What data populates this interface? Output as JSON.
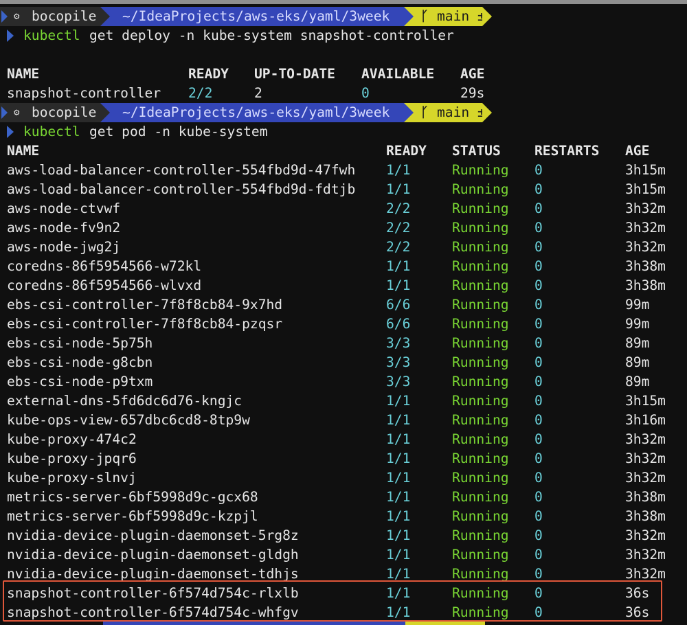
{
  "prompts": [
    {
      "user": "bocopile",
      "path": "~/IdeaProjects/aws-eks/yaml/3week",
      "branch_icon": "branch-icon",
      "branch": "main ±",
      "command": "kubectl",
      "args": "get deploy -n kube-system snapshot-controller"
    },
    {
      "user": "bocopile",
      "path": "~/IdeaProjects/aws-eks/yaml/3week",
      "branch_icon": "branch-icon",
      "branch": "main ±",
      "command": "kubectl",
      "args": "get pod -n kube-system"
    }
  ],
  "deploy_table": {
    "headers": [
      "NAME",
      "READY",
      "UP-TO-DATE",
      "AVAILABLE",
      "AGE"
    ],
    "rows": [
      [
        "snapshot-controller",
        "2/2",
        "2",
        "0",
        "29s"
      ]
    ]
  },
  "pod_table": {
    "headers": [
      "NAME",
      "READY",
      "STATUS",
      "RESTARTS",
      "AGE"
    ],
    "rows": [
      [
        "aws-load-balancer-controller-554fbd9d-47fwh",
        "1/1",
        "Running",
        "0",
        "3h15m"
      ],
      [
        "aws-load-balancer-controller-554fbd9d-fdtjb",
        "1/1",
        "Running",
        "0",
        "3h15m"
      ],
      [
        "aws-node-ctvwf",
        "2/2",
        "Running",
        "0",
        "3h32m"
      ],
      [
        "aws-node-fv9n2",
        "2/2",
        "Running",
        "0",
        "3h32m"
      ],
      [
        "aws-node-jwg2j",
        "2/2",
        "Running",
        "0",
        "3h32m"
      ],
      [
        "coredns-86f5954566-w72kl",
        "1/1",
        "Running",
        "0",
        "3h38m"
      ],
      [
        "coredns-86f5954566-wlvxd",
        "1/1",
        "Running",
        "0",
        "3h38m"
      ],
      [
        "ebs-csi-controller-7f8f8cb84-9x7hd",
        "6/6",
        "Running",
        "0",
        "99m"
      ],
      [
        "ebs-csi-controller-7f8f8cb84-pzqsr",
        "6/6",
        "Running",
        "0",
        "99m"
      ],
      [
        "ebs-csi-node-5p75h",
        "3/3",
        "Running",
        "0",
        "89m"
      ],
      [
        "ebs-csi-node-g8cbn",
        "3/3",
        "Running",
        "0",
        "89m"
      ],
      [
        "ebs-csi-node-p9txm",
        "3/3",
        "Running",
        "0",
        "89m"
      ],
      [
        "external-dns-5fd6dc6d76-kngjc",
        "1/1",
        "Running",
        "0",
        "3h15m"
      ],
      [
        "kube-ops-view-657dbc6cd8-8tp9w",
        "1/1",
        "Running",
        "0",
        "3h16m"
      ],
      [
        "kube-proxy-474c2",
        "1/1",
        "Running",
        "0",
        "3h32m"
      ],
      [
        "kube-proxy-jpqr6",
        "1/1",
        "Running",
        "0",
        "3h32m"
      ],
      [
        "kube-proxy-slnvj",
        "1/1",
        "Running",
        "0",
        "3h32m"
      ],
      [
        "metrics-server-6bf5998d9c-gcx68",
        "1/1",
        "Running",
        "0",
        "3h38m"
      ],
      [
        "metrics-server-6bf5998d9c-kzpjl",
        "1/1",
        "Running",
        "0",
        "3h38m"
      ],
      [
        "nvidia-device-plugin-daemonset-5rg8z",
        "1/1",
        "Running",
        "0",
        "3h32m"
      ],
      [
        "nvidia-device-plugin-daemonset-gldgh",
        "1/1",
        "Running",
        "0",
        "3h32m"
      ],
      [
        "nvidia-device-plugin-daemonset-tdhjs",
        "1/1",
        "Running",
        "0",
        "3h32m"
      ],
      [
        "snapshot-controller-6f574d754c-rlxlb",
        "1/1",
        "Running",
        "0",
        "36s"
      ],
      [
        "snapshot-controller-6f574d754c-whfgv",
        "1/1",
        "Running",
        "0",
        "36s"
      ]
    ]
  },
  "colors": {
    "background": "#101010",
    "text": "#e6e6e6",
    "ready": "#6ad0d9",
    "running": "#79d633",
    "prompt_command": "#79d633",
    "path_segment": "#3446b8",
    "git_segment": "#d6d62a",
    "highlight_border": "#e0573a"
  }
}
